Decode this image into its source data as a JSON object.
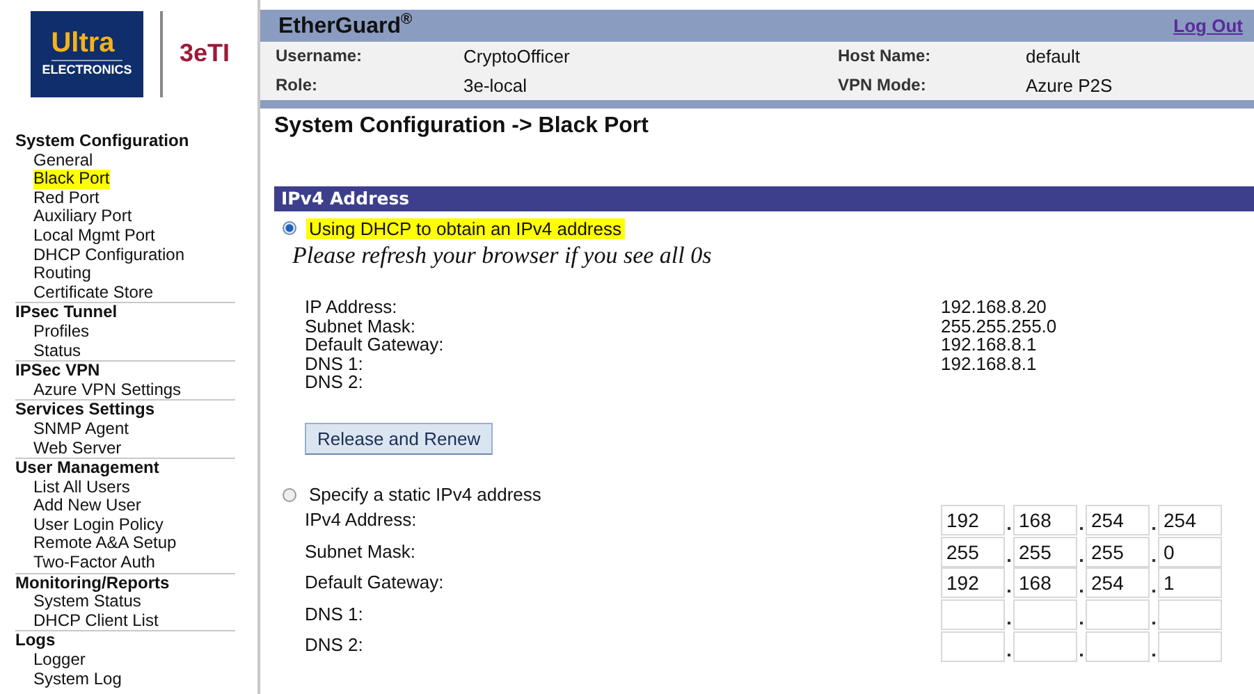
{
  "logo": {
    "brand_top": "Ultra",
    "brand_bottom": "ELECTRONICS",
    "product": "3eTI"
  },
  "sidebar": {
    "groups": [
      {
        "title": "System Configuration",
        "items": [
          {
            "label": "General",
            "selected": false
          },
          {
            "label": "Black Port",
            "selected": true
          },
          {
            "label": "Red Port",
            "selected": false
          },
          {
            "label": "Auxiliary Port",
            "selected": false
          },
          {
            "label": "Local Mgmt Port",
            "selected": false
          },
          {
            "label": "DHCP Configuration",
            "selected": false
          },
          {
            "label": "Routing",
            "selected": false
          },
          {
            "label": "Certificate Store",
            "selected": false
          }
        ]
      },
      {
        "title": "IPsec Tunnel",
        "items": [
          {
            "label": "Profiles",
            "selected": false
          },
          {
            "label": "Status",
            "selected": false
          }
        ]
      },
      {
        "title": "IPSec VPN",
        "items": [
          {
            "label": "Azure VPN Settings",
            "selected": false
          }
        ]
      },
      {
        "title": "Services Settings",
        "items": [
          {
            "label": "SNMP Agent",
            "selected": false
          },
          {
            "label": "Web Server",
            "selected": false
          }
        ]
      },
      {
        "title": "User Management",
        "items": [
          {
            "label": "List All Users",
            "selected": false
          },
          {
            "label": "Add New User",
            "selected": false
          },
          {
            "label": "User Login Policy",
            "selected": false
          },
          {
            "label": "Remote A&A Setup",
            "selected": false
          },
          {
            "label": "Two-Factor Auth",
            "selected": false
          }
        ]
      },
      {
        "title": "Monitoring/Reports",
        "items": [
          {
            "label": "System Status",
            "selected": false
          },
          {
            "label": "DHCP Client List",
            "selected": false
          }
        ]
      },
      {
        "title": "Logs",
        "items": [
          {
            "label": "Logger",
            "selected": false
          },
          {
            "label": "System Log",
            "selected": false
          }
        ]
      }
    ]
  },
  "header": {
    "title": "EtherGuard$^{®}$",
    "logout": "Log Out",
    "info": [
      {
        "label": "Username:",
        "value": "CryptoOfficer"
      },
      {
        "label": "Host Name:",
        "value": "default"
      },
      {
        "label": "Role:",
        "value": "3e-local"
      },
      {
        "label": "VPN Mode:",
        "value": "Azure P2S"
      }
    ]
  },
  "page_title": "System Configuration -> Black Port",
  "section": {
    "title": "IPv4 Address"
  },
  "dhcp": {
    "option": {
      "label": "Using DHCP to obtain an IPv4 address",
      "selected": true,
      "highlighted": true
    },
    "note": "Please refresh your browser if you see all 0s",
    "fields": [
      {
        "label": "IP Address:",
        "value": "192.168.8.20"
      },
      {
        "label": "Subnet Mask:",
        "value": "255.255.255.0"
      },
      {
        "label": "Default Gateway:",
        "value": "192.168.8.1"
      },
      {
        "label": "DNS 1:",
        "value": "192.168.8.1"
      },
      {
        "label": "DNS 2:"
      }
    ],
    "button": "Release and Renew"
  },
  "static": {
    "option": {
      "label": "Specify a static IPv4 address",
      "selected": false,
      "highlighted": false
    },
    "fields": [
      {
        "label": "IPv4 Address:",
        "octets": [
          "192",
          "168",
          "254",
          "254"
        ]
      },
      {
        "label": "Subnet Mask:",
        "octets": [
          "255",
          "255",
          "255",
          "0"
        ]
      },
      {
        "label": "Default Gateway:",
        "octets": [
          "192",
          "168",
          "254",
          "1"
        ]
      },
      {
        "label": "DNS 1:"
      },
      {
        "label": "DNS 2:"
      }
    ]
  }
}
